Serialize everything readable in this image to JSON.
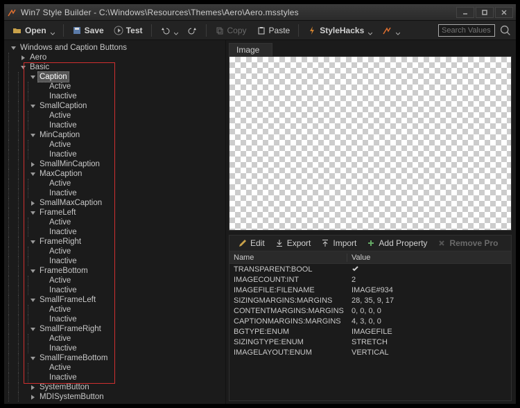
{
  "titlebar": {
    "app": "Win7 Style Builder",
    "path": "C:\\Windows\\Resources\\Themes\\Aero\\Aero.msstyles"
  },
  "toolbar": {
    "open": "Open",
    "save": "Save",
    "test": "Test",
    "copy": "Copy",
    "paste": "Paste",
    "stylehacks": "StyleHacks",
    "search_placeholder": "Search Values"
  },
  "tree": {
    "root": "Windows and Caption Buttons",
    "aero": "Aero",
    "basic": "Basic",
    "groups": [
      {
        "name": "Caption",
        "children": [
          "Active",
          "Inactive"
        ],
        "selected": true
      },
      {
        "name": "SmallCaption",
        "children": [
          "Active",
          "Inactive"
        ]
      },
      {
        "name": "MinCaption",
        "children": [
          "Active",
          "Inactive"
        ]
      },
      {
        "name": "SmallMinCaption",
        "children": []
      },
      {
        "name": "MaxCaption",
        "children": [
          "Active",
          "Inactive"
        ]
      },
      {
        "name": "SmallMaxCaption",
        "children": []
      },
      {
        "name": "FrameLeft",
        "children": [
          "Active",
          "Inactive"
        ]
      },
      {
        "name": "FrameRight",
        "children": [
          "Active",
          "Inactive"
        ]
      },
      {
        "name": "FrameBottom",
        "children": [
          "Active",
          "Inactive"
        ]
      },
      {
        "name": "SmallFrameLeft",
        "children": [
          "Active",
          "Inactive"
        ]
      },
      {
        "name": "SmallFrameRight",
        "children": [
          "Active",
          "Inactive"
        ]
      },
      {
        "name": "SmallFrameBottom",
        "children": [
          "Active",
          "Inactive"
        ]
      }
    ],
    "after": [
      "SystemButton",
      "MDISystemButton"
    ]
  },
  "image_tab": "Image",
  "prop_toolbar": {
    "edit": "Edit",
    "export": "Export",
    "import": "Import",
    "add": "Add Property",
    "remove": "Remove Pro"
  },
  "prop_headers": {
    "name": "Name",
    "value": "Value"
  },
  "props": [
    {
      "name": "TRANSPARENT:BOOL",
      "value": "__check__"
    },
    {
      "name": "IMAGECOUNT:INT",
      "value": "2"
    },
    {
      "name": "IMAGEFILE:FILENAME",
      "value": "IMAGE#934"
    },
    {
      "name": "SIZINGMARGINS:MARGINS",
      "value": "28, 35, 9, 17"
    },
    {
      "name": "CONTENTMARGINS:MARGINS",
      "value": "0, 0, 0, 0"
    },
    {
      "name": "CAPTIONMARGINS:MARGINS",
      "value": "4, 3, 0, 0"
    },
    {
      "name": "BGTYPE:ENUM",
      "value": "IMAGEFILE"
    },
    {
      "name": "SIZINGTYPE:ENUM",
      "value": "STRETCH"
    },
    {
      "name": "IMAGELAYOUT:ENUM",
      "value": "VERTICAL"
    }
  ]
}
